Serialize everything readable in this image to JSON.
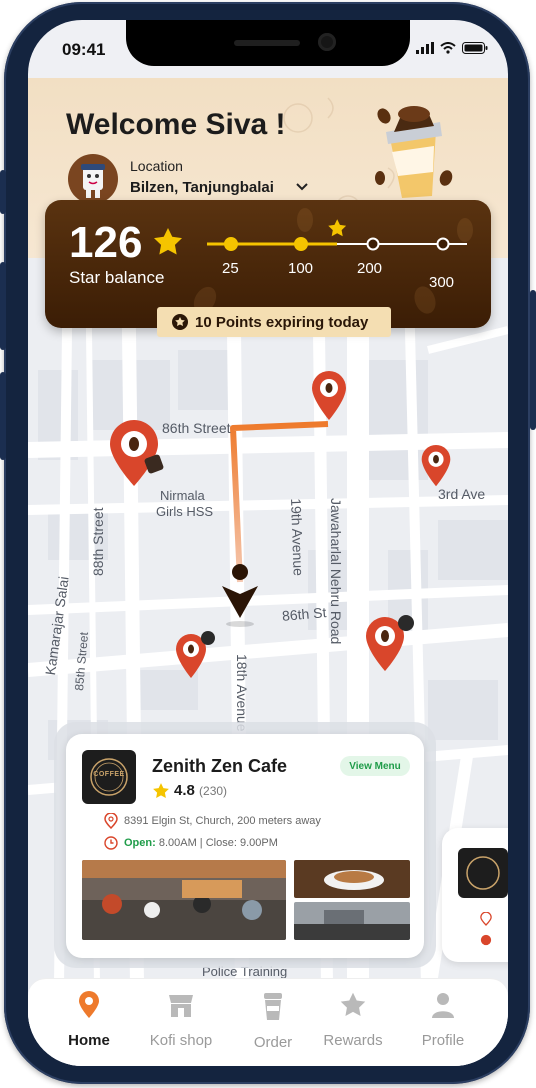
{
  "status_bar": {
    "time": "09:41"
  },
  "header": {
    "welcome": "Welcome Siva !",
    "location_label": "Location",
    "location_value": "Bilzen, Tanjungbalai"
  },
  "star_card": {
    "balance": "126",
    "label": "Star balance",
    "milestones": [
      "25",
      "100",
      "200",
      "300"
    ],
    "progress_fraction": 0.5,
    "expiring": "10 Points expiring today"
  },
  "map": {
    "streets": [
      "86th Street",
      "86th St",
      "88th Street",
      "85th Street",
      "19th Avenue",
      "18th Avenue",
      "Jawaharlal Nehru Road",
      "Kamarajar Salai",
      "3rd Ave",
      "Police Training"
    ],
    "places": [
      "Nirmala",
      "Girls HSS"
    ]
  },
  "cafe_card": {
    "name": "Zenith Zen Cafe",
    "rating": "4.8",
    "rating_count": "(230)",
    "view_menu": "View Menu",
    "address": "8391 Elgin St, Church, 200 meters away",
    "open_label": "Open:",
    "hours": "8.00AM | Close: 9.00PM",
    "logo_text": "COFFEE"
  },
  "nav": {
    "items": [
      {
        "label": "Home",
        "icon": "map-pin-icon",
        "active": true
      },
      {
        "label": "Kofi shop",
        "icon": "shop-icon",
        "active": false
      },
      {
        "label": "Order",
        "icon": "cup-icon",
        "active": false
      },
      {
        "label": "Rewards",
        "icon": "star-icon",
        "active": false
      },
      {
        "label": "Profile",
        "icon": "person-icon",
        "active": false
      }
    ]
  },
  "colors": {
    "accent_orange": "#ee7a2c",
    "pin_red": "#d9462b",
    "brown": "#3b1d05",
    "gold": "#f5c400",
    "open_green": "#1f9c49"
  }
}
